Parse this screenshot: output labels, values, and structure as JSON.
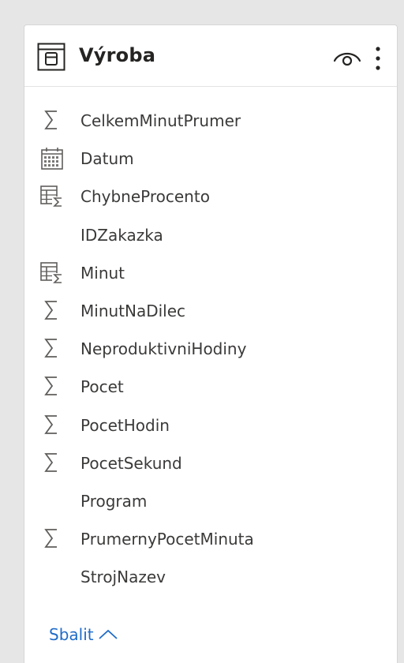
{
  "panel": {
    "title": "Výroba",
    "table_icon": "table-icon",
    "visibility_icon": "eye-icon",
    "more_icon": "more-options-icon"
  },
  "fields": [
    {
      "name": "CelkemMinutPrumer",
      "icon": "sigma-icon"
    },
    {
      "name": "Datum",
      "icon": "calendar-icon"
    },
    {
      "name": "ChybneProcento",
      "icon": "measure-icon"
    },
    {
      "name": "IDZakazka",
      "icon": ""
    },
    {
      "name": "Minut",
      "icon": "measure-icon"
    },
    {
      "name": "MinutNaDilec",
      "icon": "sigma-icon"
    },
    {
      "name": "NeproduktivniHodiny",
      "icon": "sigma-icon"
    },
    {
      "name": "Pocet",
      "icon": "sigma-icon"
    },
    {
      "name": "PocetHodin",
      "icon": "sigma-icon"
    },
    {
      "name": "PocetSekund",
      "icon": "sigma-icon"
    },
    {
      "name": "Program",
      "icon": ""
    },
    {
      "name": "PrumernyPocetMinuta",
      "icon": "sigma-icon"
    },
    {
      "name": "StrojNazev",
      "icon": ""
    }
  ],
  "footer": {
    "collapse_label": "Sbalit",
    "collapse_icon": "chevron-up-icon"
  },
  "colors": {
    "background": "#e6e6e6",
    "card": "#ffffff",
    "text": "#3b3a39",
    "title": "#252423",
    "link": "#1f6cc8",
    "icon": "#605e5c"
  }
}
